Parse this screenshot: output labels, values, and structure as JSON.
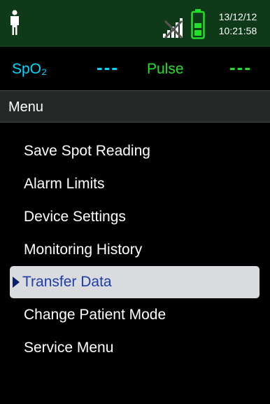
{
  "status_bar": {
    "date": "13/12/12",
    "time": "10:21:58",
    "icons": {
      "patient": "adult-patient-icon",
      "signal": "no-signal-icon",
      "battery": "battery-full-icon"
    },
    "colors": {
      "background": "#0f3a1a",
      "battery": "#22e02a"
    }
  },
  "vitals": {
    "spo2_label": "SpO₂",
    "spo2_value": "---",
    "pulse_label": "Pulse",
    "pulse_value": "---",
    "colors": {
      "spo2": "#00d7ff",
      "pulse": "#22e02a"
    }
  },
  "menu": {
    "title": "Menu",
    "selected_index": 4,
    "items": [
      {
        "label": "Save Spot Reading"
      },
      {
        "label": "Alarm Limits"
      },
      {
        "label": "Device Settings"
      },
      {
        "label": "Monitoring History"
      },
      {
        "label": "Transfer Data"
      },
      {
        "label": "Change Patient Mode"
      },
      {
        "label": "Service Menu"
      }
    ],
    "colors": {
      "selected_background": "#d9dbdf",
      "selected_text": "#1d3ea8"
    }
  }
}
